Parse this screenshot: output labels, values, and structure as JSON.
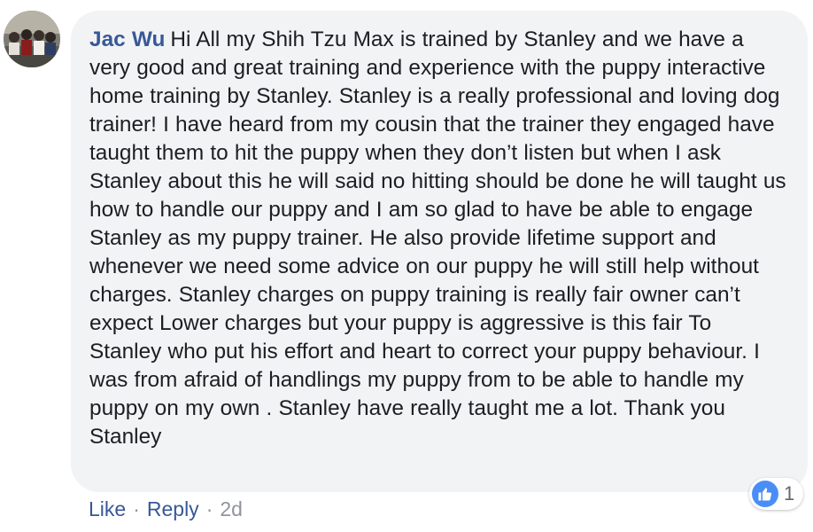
{
  "comment": {
    "author": "Jac Wu",
    "text": "Hi All my Shih Tzu Max is trained by Stanley and we have a very good and great training and experience with the puppy interactive home training by Stanley. Stanley is a really professional and loving dog trainer! I have heard from my cousin that the trainer they engaged have taught them to hit the puppy when they don’t listen but when I ask Stanley about this he will said no hitting should be done he will taught us how to handle our puppy and I am so glad to have be able to engage Stanley as my puppy trainer. He also provide lifetime support and whenever we need some advice on our puppy he will still help without charges. Stanley charges on puppy training is really fair owner can’t expect Lower charges but your puppy is aggressive is this fair To Stanley who put his effort and heart to correct your puppy behaviour. I was from afraid of handlings my puppy from to be able to handle my puppy on my own . Stanley have really taught me a lot. Thank you Stanley",
    "reactions": {
      "icon": "thumbs-up-icon",
      "count": "1",
      "color": "#4a8df7"
    },
    "actions": {
      "like_label": "Like",
      "separator": "·",
      "reply_label": "Reply",
      "timestamp": "2d"
    }
  },
  "colors": {
    "link": "#385898",
    "bubble": "#f2f3f5",
    "text": "#1c1e21",
    "meta": "#90949c"
  }
}
